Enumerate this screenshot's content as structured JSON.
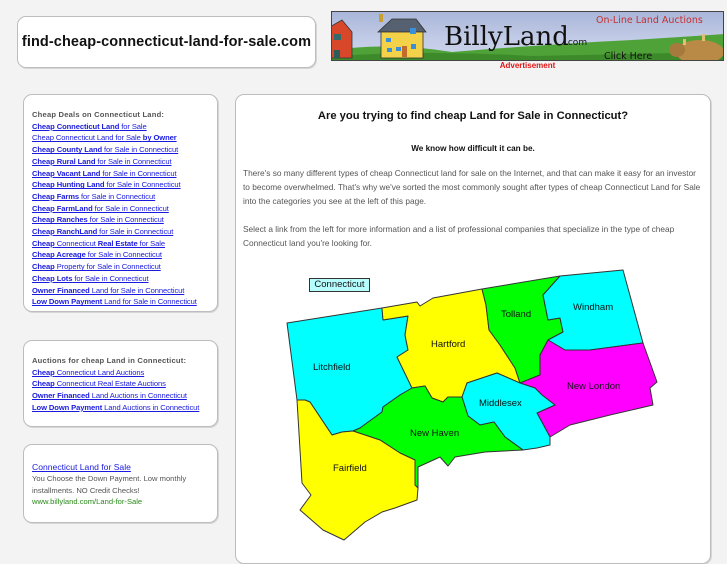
{
  "header": {
    "domain_title": "find-cheap-connecticut-land-for-sale.com",
    "ad": {
      "brand": "BillyLand",
      "brand_suffix": ".com",
      "tagline": "On-Line Land Auctions",
      "cta": "Click Here",
      "label": "Advertisement"
    }
  },
  "sidebar": {
    "deals": {
      "heading": "Cheap Deals on Connecticut Land:",
      "links": [
        {
          "bold": "Cheap Connecticut Land",
          "rest": " for Sale"
        },
        {
          "bold": "",
          "rest": "Cheap Connecticut Land for Sale by Owner",
          "all_bold_tail": "by Owner"
        },
        {
          "bold": "Cheap County Land",
          "rest": " for Sale in Connecticut"
        },
        {
          "bold": "Cheap Rural Land",
          "rest": " for Sale in Connecticut"
        },
        {
          "bold": "Cheap Vacant Land",
          "rest": " for Sale in Connecticut"
        },
        {
          "bold": "Cheap Hunting Land",
          "rest": " for Sale in Connecticut"
        },
        {
          "bold": "Cheap Farms",
          "rest": " for Sale in Connecticut"
        },
        {
          "bold": "Cheap FarmLand",
          "rest": " for Sale in Connecticut"
        },
        {
          "bold": "Cheap Ranches",
          "rest": " for Sale in Connecticut"
        },
        {
          "bold": "Cheap RanchLand",
          "rest": " for Sale in Connecticut"
        },
        {
          "bold": "Cheap",
          "rest": " Connecticut ",
          "tail_bold": "Real Estate",
          "tail": " for Sale"
        },
        {
          "bold": "Cheap Acreage",
          "rest": " for Sale in Connecticut"
        },
        {
          "bold": "Cheap",
          "rest": " Property for Sale in Connecticut"
        },
        {
          "bold": "Cheap Lots",
          "rest": " for Sale in Connecticut"
        },
        {
          "bold": "Owner Financed",
          "rest": " Land for Sale in Connecticut"
        },
        {
          "bold": "Low Down Payment",
          "rest": " Land for Sale in Connecticut"
        }
      ]
    },
    "auctions": {
      "heading": "Auctions for cheap Land in Connecticut:",
      "links": [
        {
          "bold": "Cheap",
          "rest": " Connecticut Land Auctions"
        },
        {
          "bold": "Cheap",
          "rest": " Connecticut Real Estate Auctions"
        },
        {
          "bold": "Owner Financed",
          "rest": " Land Auctions in Connecticut"
        },
        {
          "bold": "Low Down Payment",
          "rest": " Land Auctions in Connecticut"
        }
      ]
    },
    "text_ad": {
      "title": "Connecticut Land for Sale",
      "body": "You Choose the Down Payment. Low monthly installments. NO Credit Checks!",
      "url": "www.billyland.com/Land-for-Sale"
    }
  },
  "main": {
    "heading": "Are you trying to find cheap Land for Sale in Connecticut?",
    "subheading": "We know how difficult it can be.",
    "paragraphs": [
      "There's so many different types of cheap Connecticut land for sale on the Internet, and that can make it easy for an investor to become overwhelmed. That's why we've sorted the most commonly sought after types of cheap Connecticut Land for Sale into the categories you see at the left of this page.",
      "Select a link from the left for more information and a list of professional companies that specialize in the type of cheap Connecticut land you're looking for."
    ],
    "map": {
      "state_label": "Connecticut",
      "counties": [
        {
          "name": "Litchfield",
          "color": "#00ffff"
        },
        {
          "name": "Hartford",
          "color": "#ffff00"
        },
        {
          "name": "Tolland",
          "color": "#00ff00"
        },
        {
          "name": "Windham",
          "color": "#00ffff"
        },
        {
          "name": "New London",
          "color": "#ff00ff"
        },
        {
          "name": "Middlesex",
          "color": "#00ffff"
        },
        {
          "name": "New Haven",
          "color": "#00ff00"
        },
        {
          "name": "Fairfield",
          "color": "#ffff00"
        }
      ]
    }
  }
}
